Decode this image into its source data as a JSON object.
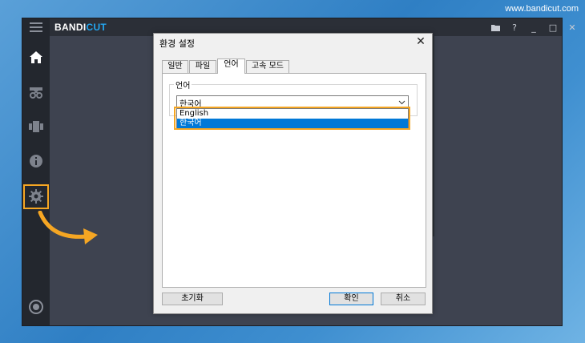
{
  "watermark": "www.bandicut.com",
  "app": {
    "logo_main": "BANDI",
    "logo_accent": "CUT",
    "sidebar": [
      {
        "name": "menu-icon"
      },
      {
        "name": "home-icon"
      },
      {
        "name": "cut-icon"
      },
      {
        "name": "join-icon"
      },
      {
        "name": "info-icon"
      },
      {
        "name": "settings-icon"
      },
      {
        "name": "record-icon"
      }
    ],
    "window_controls": {
      "folder": "folder-icon",
      "help": "?",
      "minimize": "_",
      "maximize": "□",
      "close": "✕"
    }
  },
  "dialog": {
    "title": "환경 설정",
    "close": "✕",
    "tabs": [
      {
        "label": "일반",
        "active": false
      },
      {
        "label": "파일",
        "active": false
      },
      {
        "label": "언어",
        "active": true
      },
      {
        "label": "고속 모드",
        "active": false
      }
    ],
    "language_group": {
      "legend": "언어",
      "selected": "한국어",
      "options": [
        {
          "label": "English",
          "selected": false
        },
        {
          "label": "한국어",
          "selected": true
        }
      ]
    },
    "buttons": {
      "reset": "초기화",
      "ok": "확인",
      "cancel": "취소"
    }
  },
  "colors": {
    "accent": "#f5a623",
    "selection": "#0078d7",
    "brand": "#23a6f0"
  }
}
